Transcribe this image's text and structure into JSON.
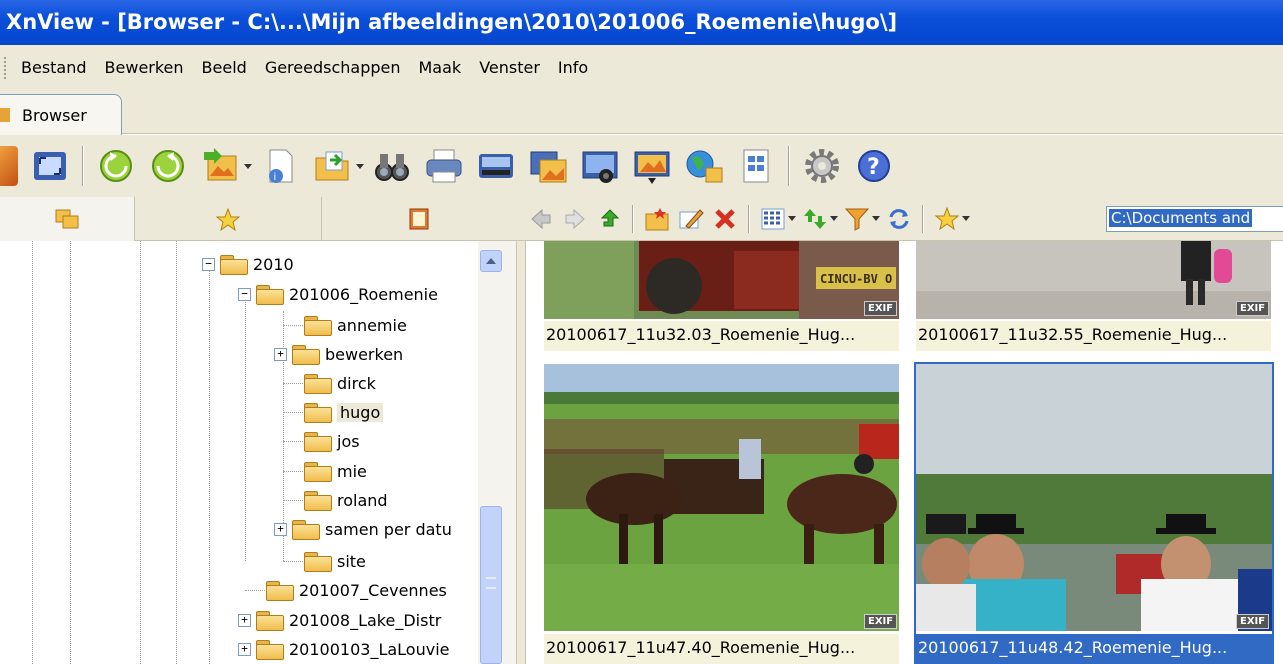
{
  "window": {
    "title": "XnView - [Browser - C:\\...\\Mijn afbeeldingen\\2010\\201006_Roemenie\\hugo\\]"
  },
  "menu": [
    "Bestand",
    "Bewerken",
    "Beeld",
    "Gereedschappen",
    "Maak",
    "Venster",
    "Info"
  ],
  "tab": {
    "label": "Browser"
  },
  "toolbar": {
    "icons": [
      "fullscreen-icon",
      "fit-window-icon",
      "rotate-left-icon",
      "rotate-right-icon",
      "convert-icon",
      "file-info-icon",
      "export-icon",
      "find-icon",
      "print-icon",
      "scan-icon",
      "batch-icon",
      "screenshot-icon",
      "slideshow-icon",
      "web-page-icon",
      "contact-sheet-icon",
      "settings-icon",
      "help-icon"
    ]
  },
  "left_panel_tabs": [
    "folders-tab-icon",
    "favorites-tab-icon",
    "categories-tab-icon"
  ],
  "browser_toolbar": {
    "icons": [
      "back-icon",
      "forward-icon",
      "up-icon",
      "new-folder-icon",
      "rename-icon",
      "delete-icon",
      "view-mode-icon",
      "sort-icon",
      "filter-icon",
      "refresh-icon",
      "favorite-star-icon"
    ],
    "path": "C:\\Documents and"
  },
  "tree": {
    "nodes": [
      {
        "label": "2010",
        "expander": "−"
      },
      {
        "label": "201006_Roemenie",
        "expander": "−"
      },
      {
        "label": "annemie",
        "expander": ""
      },
      {
        "label": "bewerken",
        "expander": "+"
      },
      {
        "label": "dirck",
        "expander": ""
      },
      {
        "label": "hugo",
        "expander": ""
      },
      {
        "label": "jos",
        "expander": ""
      },
      {
        "label": "mie",
        "expander": ""
      },
      {
        "label": "roland",
        "expander": ""
      },
      {
        "label": "samen per datu",
        "expander": "+"
      },
      {
        "label": "site",
        "expander": ""
      },
      {
        "label": "201007_Cevennes",
        "expander": ""
      },
      {
        "label": "201008_Lake_Distr",
        "expander": "+"
      },
      {
        "label": "20100103_LaLouvie",
        "expander": "+"
      }
    ]
  },
  "thumbnails": [
    {
      "caption": "20100617_11u32.03_Roemenie_Hug...",
      "badge": "EXIF",
      "sign": "CINCU-BV O"
    },
    {
      "caption": "20100617_11u32.55_Roemenie_Hug...",
      "badge": "EXIF"
    },
    {
      "caption": "20100617_11u47.40_Roemenie_Hug...",
      "badge": "EXIF"
    },
    {
      "caption": "20100617_11u48.42_Roemenie_Hug...",
      "badge": "EXIF",
      "selected": true
    }
  ],
  "colors": {
    "titlebar": "#0a4fd9",
    "selection": "#316ac5",
    "chrome": "#ece9d8"
  }
}
